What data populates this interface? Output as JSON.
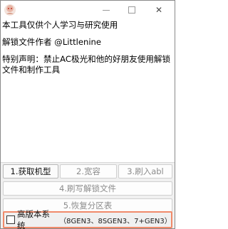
{
  "titlebar": {
    "icons": {
      "app": "app-avatar-icon",
      "minimize": "minimize-icon",
      "maximize": "maximize-icon",
      "close": "close-icon"
    },
    "close_glyph": "✕"
  },
  "log": {
    "line1": "本工具仅供个人学习与研究使用",
    "line2": "解锁文件作者 @Littlenine",
    "line3": "特别声明：禁止AC极光和他的好朋友使用解锁文件和制作工具"
  },
  "buttons": {
    "get_model": "1.获取机型",
    "wide": "2.宽容",
    "flash_abl": "3.刷入abl",
    "flash_unlock": "4.刷写解锁文件",
    "restore_partition": "5.恢复分区表"
  },
  "checkbox": {
    "label": "高版本系统",
    "note": "（8GEN3、8SGEN3、7+GEN3）",
    "checked": false
  },
  "colors": {
    "highlight_border": "#f08a6a",
    "disabled_text": "#8c8c8c",
    "enabled_text": "#111111"
  }
}
